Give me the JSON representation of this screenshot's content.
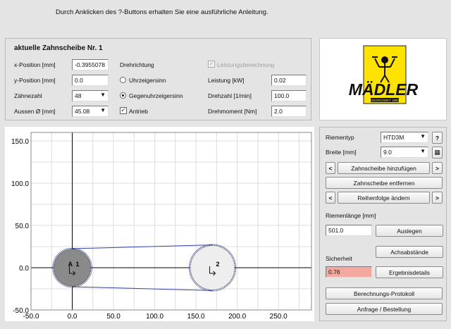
{
  "hint": "Durch Anklicken des ?-Buttons erhalten Sie eine ausführliche Anleitung.",
  "panel": {
    "title": "aktuelle Zahnscheibe Nr. 1",
    "x_label": "x-Position [mm]",
    "x_value": "-0.3955078",
    "y_label": "y-Position [mm]",
    "y_value": "0.0",
    "teeth_label": "Zähnezahl",
    "teeth_value": "48",
    "outer_label": "Aussen Ø [mm]",
    "outer_value": "45.08",
    "direction_label": "Drehrichtung",
    "cw_label": "Uhrzeigersinn",
    "ccw_label": "Gegenuhrzeigersinn",
    "drive_label": "Antrieb",
    "power_calc_label": "Leistungsberechnung",
    "power_label": "Leistung [kW]",
    "power_value": "0.02",
    "speed_label": "Drehzahl [1/min]",
    "speed_value": "100.0",
    "torque_label": "Drehmoment [Nm]",
    "torque_value": "2.0"
  },
  "logo": {
    "brand": "MÄDLER",
    "founded": "GEGRÜNDET 1882"
  },
  "plot": {
    "x_ticks": [
      "-50.0",
      "0.0",
      "50.0",
      "100.0",
      "150.0",
      "200.0",
      "250.0"
    ],
    "y_ticks": [
      "150.0",
      "100.0",
      "50.0",
      "0.0",
      "-50.0"
    ],
    "pulleys": [
      {
        "number": "1",
        "sub": "A",
        "x": 0,
        "y": 0,
        "r": 22.5
      },
      {
        "number": "2",
        "sub": "",
        "x": 170,
        "y": 0,
        "r": 27
      }
    ]
  },
  "controls": {
    "belt_type_label": "Riementyp",
    "belt_type_value": "HTD3M",
    "help_label": "?",
    "width_label": "Breite [mm]",
    "width_value": "9.0",
    "add_pulley": "Zahnscheibe hinzufügen",
    "remove_pulley": "Zahnscheibe entfernen",
    "change_order": "Reihenfolge ändern",
    "prev": "<",
    "next": ">",
    "belt_length_label": "Riemenlänge [mm]",
    "belt_length_value": "501.0",
    "layout_btn": "Auslegen",
    "axis_btn": "Achsabstände",
    "safety_label": "Sicherheit",
    "safety_value": "0.76",
    "results_btn": "Ergebnisdetails",
    "protocol_btn": "Berechnungs-Protokoll",
    "order_btn": "Anfrage / Bestellung",
    "danger_color": "#f4a9a0"
  }
}
